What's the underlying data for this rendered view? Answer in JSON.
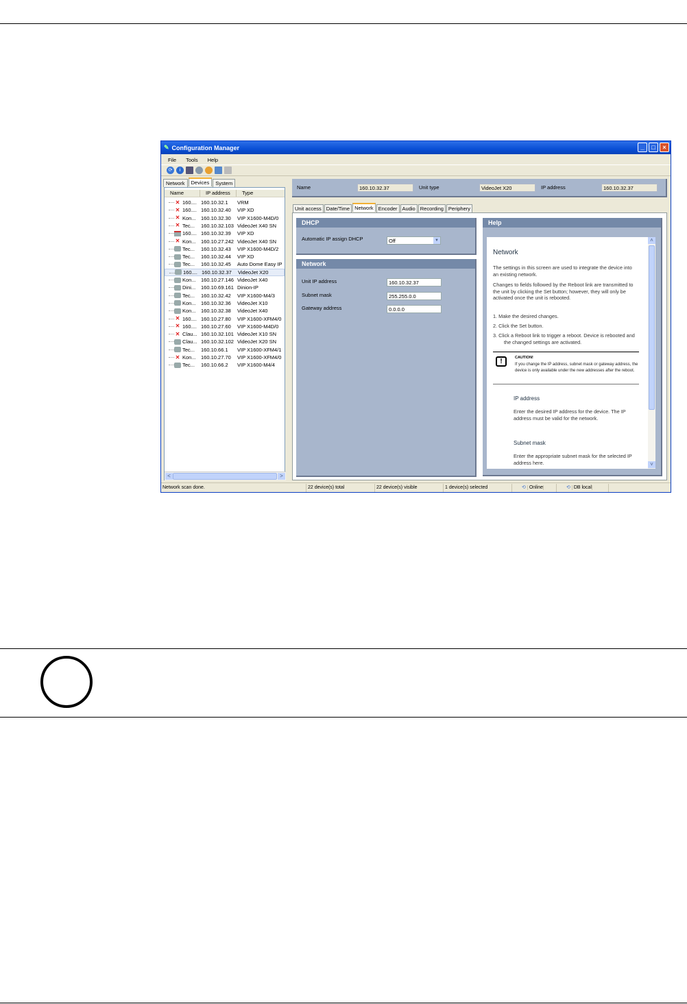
{
  "window": {
    "title": "Configuration Manager",
    "menu": [
      "File",
      "Tools",
      "Help"
    ]
  },
  "left_tabs": [
    "Network",
    "Devices",
    "System"
  ],
  "list": {
    "columns": [
      "Name",
      "IP address",
      "Type"
    ],
    "rows": [
      {
        "name": "160....",
        "ip": "160.10.32.1",
        "type": "VRM",
        "status": "error"
      },
      {
        "name": "160....",
        "ip": "160.10.32.40",
        "type": "VIP XD",
        "status": "error"
      },
      {
        "name": "Kon...",
        "ip": "160.10.32.30",
        "type": "VIP X1600-M4D/0",
        "status": "error"
      },
      {
        "name": "Tec...",
        "ip": "160.10.32.103",
        "type": "VideoJet X40 SN",
        "status": "error"
      },
      {
        "name": "160....",
        "ip": "160.10.32.39",
        "type": "VIP XD",
        "status": "locked"
      },
      {
        "name": "Kon...",
        "ip": "160.10.27.242",
        "type": "VideoJet X40 SN",
        "status": "error"
      },
      {
        "name": "Tec...",
        "ip": "160.10.32.43",
        "type": "VIP X1600-M4D/2",
        "status": "ok"
      },
      {
        "name": "Tec...",
        "ip": "160.10.32.44",
        "type": "VIP XD",
        "status": "ok"
      },
      {
        "name": "Tec...",
        "ip": "160.10.32.45",
        "type": "Auto Dome Easy IP",
        "status": "ok"
      },
      {
        "name": "160....",
        "ip": "160.10.32.37",
        "type": "VideoJet X20",
        "status": "ok"
      },
      {
        "name": "Kon...",
        "ip": "160.10.27.146",
        "type": "VideoJet X40",
        "status": "ok"
      },
      {
        "name": "Dini...",
        "ip": "160.10.69.161",
        "type": "Dinion-IP",
        "status": "ok"
      },
      {
        "name": "Tec...",
        "ip": "160.10.32.42",
        "type": "VIP X1600-M4/3",
        "status": "ok"
      },
      {
        "name": "Kon...",
        "ip": "160.10.32.36",
        "type": "VideoJet X10",
        "status": "ok"
      },
      {
        "name": "Kon...",
        "ip": "160.10.32.38",
        "type": "VideoJet X40",
        "status": "ok"
      },
      {
        "name": "160....",
        "ip": "160.10.27.80",
        "type": "VIP X1600-XFM4/0",
        "status": "error"
      },
      {
        "name": "160....",
        "ip": "160.10.27.60",
        "type": "VIP X1600-M4D/0",
        "status": "error"
      },
      {
        "name": "Clau...",
        "ip": "160.10.32.101",
        "type": "VideoJet X10 SN",
        "status": "error"
      },
      {
        "name": "Clau...",
        "ip": "160.10.32.102",
        "type": "VideoJet X20 SN",
        "status": "ok"
      },
      {
        "name": "Tec...",
        "ip": "160.10.66.1",
        "type": "VIP X1600-XFM4/1",
        "status": "ok"
      },
      {
        "name": "Kon...",
        "ip": "160.10.27.70",
        "type": "VIP X1600-XFM4/0",
        "status": "error"
      },
      {
        "name": "Tec...",
        "ip": "160.10.66.2",
        "type": "VIP X1600-M4/4",
        "status": "ok"
      }
    ],
    "selected_index": 9
  },
  "info": {
    "name_label": "Name",
    "name_value": "160.10.32.37",
    "unit_type_label": "Unit type",
    "unit_type_value": "VideoJet X20",
    "ip_label": "IP address",
    "ip_value": "160.10.32.37"
  },
  "right_tabs": [
    "Unit access",
    "Date/Time",
    "Network",
    "Encoder",
    "Audio",
    "Recording",
    "Periphery"
  ],
  "dhcp": {
    "title": "DHCP",
    "label": "Automatic IP assign DHCP",
    "value": "Off"
  },
  "network": {
    "title": "Network",
    "unit_ip_label": "Unit IP address",
    "unit_ip": "160.10.32.37",
    "subnet_label": "Subnet mask",
    "subnet": "255.255.0.0",
    "gateway_label": "Gateway address",
    "gateway": "0.0.0.0"
  },
  "help": {
    "title": "Help",
    "heading": "Network",
    "p1": "The settings in this screen are used to integrate the device into an existing network.",
    "p2": "Changes to fields followed by the Reboot link are transmitted to the unit by clicking the Set button; however, they will only be activated once the unit is rebooted.",
    "steps": [
      "1.  Make the desired changes.",
      "2.  Click the Set button.",
      "3.  Click a Reboot link to trigger a reboot. Device is rebooted and the changed settings are activated."
    ],
    "caution_title": "CAUTION!",
    "caution_text": "If you change the IP address, subnet mask or gateway address, the device is only available under the new addresses after the reboot.",
    "ip_heading": "IP address",
    "ip_text": "Enter the desired IP address for the device. The IP address must be valid for the network.",
    "subnet_heading": "Subnet mask",
    "subnet_text": "Enter the appropriate subnet mask for the selected IP address here."
  },
  "status": {
    "message": "Network scan done.",
    "total": "22 device(s) total",
    "visible": "22 device(s) visible",
    "selected": "1 device(s) selected",
    "online": "Online",
    "db": "DB local"
  }
}
